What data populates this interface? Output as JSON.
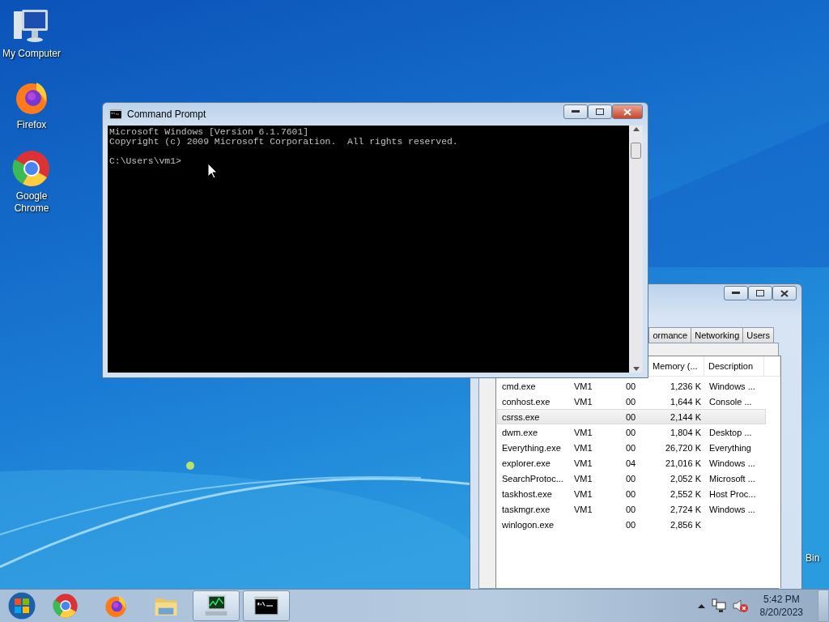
{
  "desktop_icons": [
    {
      "label": "My Computer",
      "kind": "computer"
    },
    {
      "label": "Firefox",
      "kind": "firefox"
    },
    {
      "label": "Google Chrome",
      "kind": "chrome"
    }
  ],
  "recycle_bin_label": "Bin",
  "task_manager": {
    "tabs": [
      {
        "label": "ormance",
        "selected": false
      },
      {
        "label": "Networking",
        "selected": false
      },
      {
        "label": "Users",
        "selected": false
      }
    ],
    "columns": [
      "Memory (...",
      "Description"
    ],
    "rows": [
      {
        "name": "cmd.exe",
        "user": "VM1",
        "cpu": "00",
        "memory": "1,236 K",
        "description": "Windows ...",
        "selected": false
      },
      {
        "name": "conhost.exe",
        "user": "VM1",
        "cpu": "00",
        "memory": "1,644 K",
        "description": "Console ...",
        "selected": false
      },
      {
        "name": "csrss.exe",
        "cpu": "00",
        "memory": "2,144 K",
        "selected": true
      },
      {
        "name": "dwm.exe",
        "user": "VM1",
        "cpu": "00",
        "memory": "1,804 K",
        "description": "Desktop ...",
        "selected": false
      },
      {
        "name": "Everything.exe",
        "user": "VM1",
        "cpu": "00",
        "memory": "26,720 K",
        "description": "Everything",
        "selected": false
      },
      {
        "name": "explorer.exe",
        "user": "VM1",
        "cpu": "04",
        "memory": "21,016 K",
        "description": "Windows ...",
        "selected": false
      },
      {
        "name": "SearchProtoc...",
        "user": "VM1",
        "cpu": "00",
        "memory": "2,052 K",
        "description": "Microsoft ...",
        "selected": false
      },
      {
        "name": "taskhost.exe",
        "user": "VM1",
        "cpu": "00",
        "memory": "2,552 K",
        "description": "Host Proc...",
        "selected": false
      },
      {
        "name": "taskmgr.exe",
        "user": "VM1",
        "cpu": "00",
        "memory": "2,724 K",
        "description": "Windows ...",
        "selected": false
      },
      {
        "name": "winlogon.exe",
        "cpu": "00",
        "memory": "2,856 K",
        "selected": false
      }
    ]
  },
  "command_prompt": {
    "title": "Command Prompt",
    "output": [
      "Microsoft Windows [Version 6.1.7601]",
      "Copyright (c) 2009 Microsoft Corporation.  All rights reserved."
    ],
    "prompt": "C:\\Users\\vm1>"
  },
  "taskbar": {
    "items": [
      {
        "kind": "chrome",
        "active": false
      },
      {
        "kind": "firefox",
        "active": false
      },
      {
        "kind": "explorer",
        "active": false
      },
      {
        "kind": "taskmgr",
        "active": true
      },
      {
        "kind": "cmd",
        "active": true
      }
    ],
    "time": "5:42 PM",
    "date": "8/20/2023"
  }
}
